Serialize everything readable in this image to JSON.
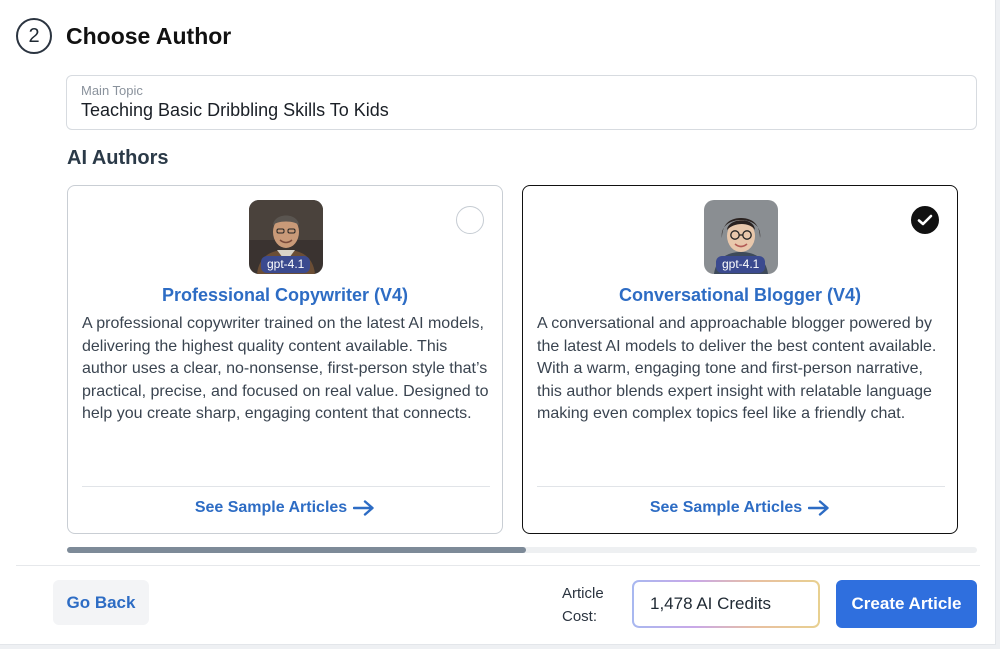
{
  "step": {
    "number": "2",
    "title": "Choose Author"
  },
  "main_topic": {
    "label": "Main Topic",
    "value": "Teaching Basic Dribbling Skills To Kids"
  },
  "ai_authors": {
    "heading": "AI Authors",
    "cards": [
      {
        "avatar": "man-with-glasses-avatar",
        "model": "gpt-4.1",
        "name": "Professional Copywriter (V4)",
        "description": "A professional copywriter trained on the latest AI models, delivering the highest quality content available. This author uses a clear, no-nonsense, first-person style that’s practical, precise, and focused on real value. Designed to help you create sharp, engaging content that connects.",
        "link": "See Sample Articles",
        "selected": false
      },
      {
        "avatar": "woman-with-glasses-avatar",
        "model": "gpt-4.1",
        "name": "Conversational Blogger (V4)",
        "description": "A conversational and approachable blogger powered by the latest AI models to deliver the best content available. With a warm, engaging tone and first-person narrative, this author blends expert insight with relatable language making even complex topics feel like a friendly chat.",
        "link": "See Sample Articles",
        "selected": true
      }
    ]
  },
  "footer": {
    "go_back": "Go Back",
    "cost_label": "Article Cost:",
    "credits": "1,478 AI Credits",
    "create": "Create Article"
  },
  "colors": {
    "accent": "#2d6cc4",
    "primary_button": "#2f6fde",
    "badge": "#3b4a8f"
  }
}
